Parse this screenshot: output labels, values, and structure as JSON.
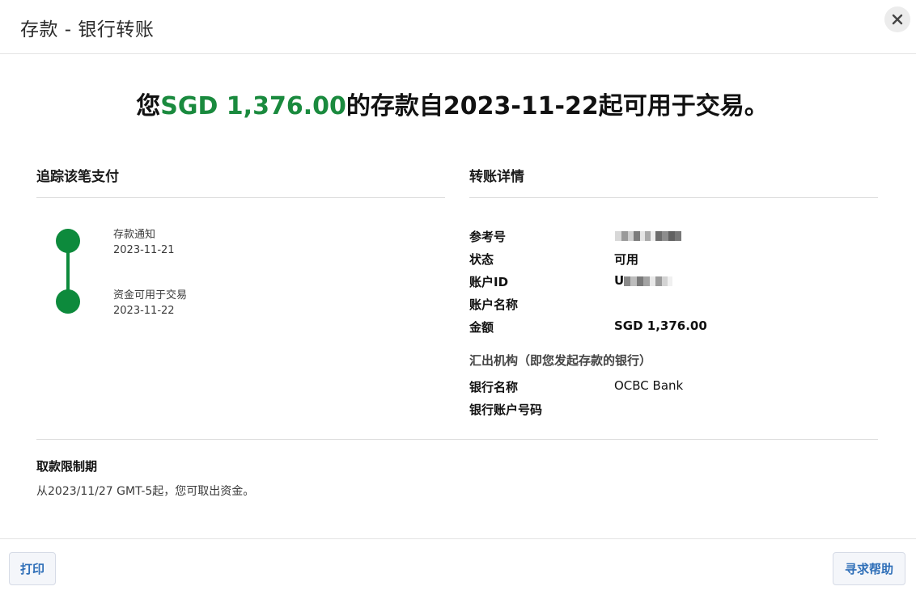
{
  "modal": {
    "title": "存款 - 银行转账"
  },
  "headline": {
    "prefix": "您",
    "amount": "SGD 1,376.00",
    "suffix": "的存款自2023-11-22起可用于交易。"
  },
  "tracking": {
    "title": "追踪该笔支付",
    "steps": [
      {
        "label": "存款通知",
        "date": "2023-11-21"
      },
      {
        "label": "资金可用于交易",
        "date": "2023-11-22"
      }
    ]
  },
  "details": {
    "title": "转账详情",
    "rows": [
      {
        "label": "参考号",
        "value": ""
      },
      {
        "label": "状态",
        "value": "可用"
      },
      {
        "label": "账户ID",
        "value": "U"
      },
      {
        "label": "账户名称",
        "value": ""
      },
      {
        "label": "金额",
        "value": "SGD 1,376.00"
      }
    ],
    "source_heading": "汇出机构（即您发起存款的银行）",
    "source_rows": [
      {
        "label": "银行名称",
        "value": "OCBC Bank"
      },
      {
        "label": "银行账户号码",
        "value": ""
      }
    ]
  },
  "withdrawal": {
    "title": "取款限制期",
    "text": "从2023/11/27 GMT-5起，您可取出资金。"
  },
  "footer": {
    "print_label": "打印",
    "help_label": "寻求帮助"
  },
  "colors": {
    "accent_green": "#1a8a3e",
    "timeline_green": "#0d8a3c",
    "link_blue": "#2f6fb8"
  }
}
